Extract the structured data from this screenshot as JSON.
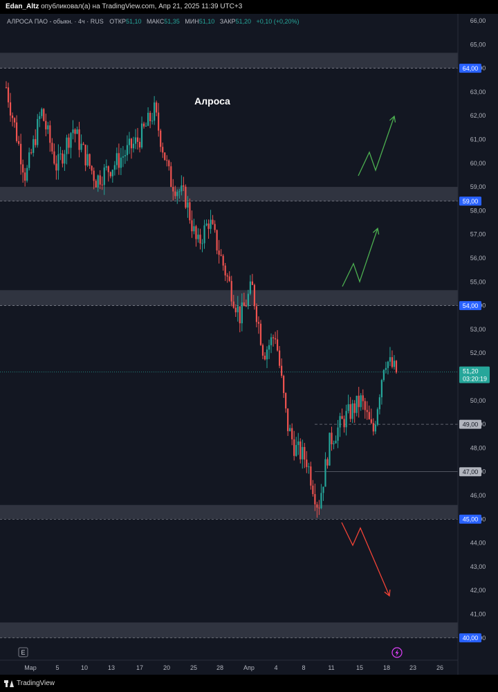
{
  "header": {
    "author": "Edan_Altz",
    "published_text": "опубликовал(а) на TradingView.com, Апр 21, 2025 11:39 UTC+3"
  },
  "legend": {
    "symbol": "АЛРОСА ПАО - обыкн. · 4ч · RUS",
    "open_label": "ОТКР",
    "open": "51,10",
    "high_label": "МАКС",
    "high": "51,35",
    "low_label": "МИН",
    "low": "51,10",
    "close_label": "ЗАКР",
    "close": "51,20",
    "change": "+0,10 (+0,20%)"
  },
  "footer": {
    "brand": "TradingView"
  },
  "colors": {
    "background": "#131722",
    "zone": "#363a45",
    "up": "#26a69a",
    "down": "#ef5350",
    "label_blue": "#2962ff",
    "label_gray": "#b2b5be",
    "price_tag": "#26a69a",
    "arrow_green": "#4caf50",
    "arrow_red": "#f44336"
  },
  "chart_data": {
    "type": "candlestick",
    "title": "Алроса",
    "ylim": [
      39.5,
      66.3
    ],
    "y_ticks": [
      "66,00",
      "65,00",
      "64,00",
      "63,00",
      "62,00",
      "61,00",
      "60,00",
      "59,00",
      "58,00",
      "57,00",
      "56,00",
      "55,00",
      "54,00",
      "53,00",
      "52,00",
      "51,00",
      "50,00",
      "49,00",
      "48,00",
      "47,00",
      "46,00",
      "45,00",
      "44,00",
      "43,00",
      "42,00",
      "41,00",
      "40,00"
    ],
    "x_ticks": [
      "Мар",
      "5",
      "10",
      "13",
      "17",
      "20",
      "25",
      "28",
      "Апр",
      "4",
      "8",
      "11",
      "15",
      "18",
      "23",
      "26"
    ],
    "zones": [
      {
        "from": 64.0,
        "to": 64.65,
        "label": "64,00"
      },
      {
        "from": 58.4,
        "to": 59.0,
        "label": "59,00"
      },
      {
        "from": 54.0,
        "to": 54.65,
        "label": "54,00"
      },
      {
        "from": 45.0,
        "to": 45.6,
        "label": "45,00"
      },
      {
        "from": 40.0,
        "to": 40.65,
        "label": "40,00"
      }
    ],
    "levels": [
      {
        "value": 49.0,
        "label": "49,00",
        "style": "dashed"
      },
      {
        "value": 47.0,
        "label": "47,00",
        "style": "solid"
      }
    ],
    "last_price": {
      "value": 51.2,
      "label": "51,20",
      "countdown": "03:20:19"
    },
    "key_points": [
      {
        "t": 0,
        "price": 63.2
      },
      {
        "t": 0.05,
        "price": 59.4
      },
      {
        "t": 0.09,
        "price": 62.2
      },
      {
        "t": 0.13,
        "price": 59.8
      },
      {
        "t": 0.17,
        "price": 61.5
      },
      {
        "t": 0.23,
        "price": 59.3
      },
      {
        "t": 0.28,
        "price": 60.0
      },
      {
        "t": 0.34,
        "price": 61.0
      },
      {
        "t": 0.38,
        "price": 62.2
      },
      {
        "t": 0.42,
        "price": 59.3
      },
      {
        "t": 0.46,
        "price": 58.5
      },
      {
        "t": 0.49,
        "price": 56.5
      },
      {
        "t": 0.52,
        "price": 57.6
      },
      {
        "t": 0.57,
        "price": 55.0
      },
      {
        "t": 0.6,
        "price": 53.5
      },
      {
        "t": 0.63,
        "price": 54.8
      },
      {
        "t": 0.66,
        "price": 52.0
      },
      {
        "t": 0.69,
        "price": 52.8
      },
      {
        "t": 0.72,
        "price": 49.0
      },
      {
        "t": 0.74,
        "price": 48.0
      },
      {
        "t": 0.77,
        "price": 47.5
      },
      {
        "t": 0.8,
        "price": 45.5
      },
      {
        "t": 0.83,
        "price": 48.3
      },
      {
        "t": 0.87,
        "price": 49.3
      },
      {
        "t": 0.91,
        "price": 50.0
      },
      {
        "t": 0.94,
        "price": 48.6
      },
      {
        "t": 0.97,
        "price": 51.8
      },
      {
        "t": 1.0,
        "price": 51.2
      }
    ]
  }
}
